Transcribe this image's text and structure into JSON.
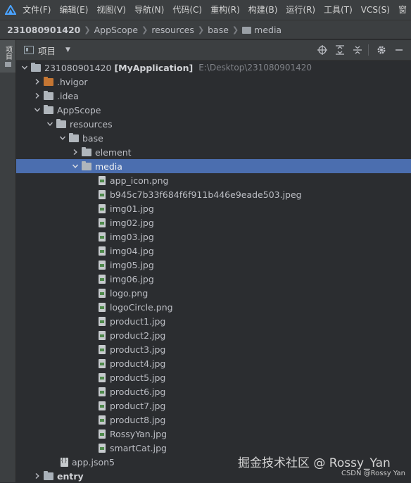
{
  "menu": {
    "items": [
      "文件(F)",
      "编辑(E)",
      "视图(V)",
      "导航(N)",
      "代码(C)",
      "重构(R)",
      "构建(B)",
      "运行(R)",
      "工具(T)",
      "VCS(S)",
      "窗"
    ]
  },
  "breadcrumb": {
    "items": [
      "231080901420",
      "AppScope",
      "resources",
      "base",
      "media"
    ]
  },
  "stripe": {
    "tab_label": "项目"
  },
  "project_panel": {
    "title": "项目"
  },
  "tree": {
    "root": {
      "name": "231080901420",
      "module": "[MyApplication]",
      "path": "E:\\Desktop\\231080901420"
    },
    "hvigor": ".hvigor",
    "idea": ".idea",
    "appscope": "AppScope",
    "resources": "resources",
    "base": "base",
    "element": "element",
    "media": "media",
    "media_files": [
      "app_icon.png",
      "b945c7b33f684f6f911b446e9eade503.jpeg",
      "img01.jpg",
      "img02.jpg",
      "img03.jpg",
      "img04.jpg",
      "img05.jpg",
      "img06.jpg",
      "logo.png",
      "logoCircle.png",
      "product1.jpg",
      "product2.jpg",
      "product3.jpg",
      "product4.jpg",
      "product5.jpg",
      "product6.jpg",
      "product7.jpg",
      "product8.jpg",
      "RossyYan.jpg",
      "smartCat.jpg"
    ],
    "app_json": "app.json5",
    "entry": "entry"
  },
  "watermark": {
    "main": "掘金技术社区 @ Rossy_Yan",
    "small": "CSDN @Rossy Yan"
  },
  "colors": {
    "selection": "#4b6eaf",
    "background": "#2b2d30",
    "folder_orange": "#c57633"
  }
}
